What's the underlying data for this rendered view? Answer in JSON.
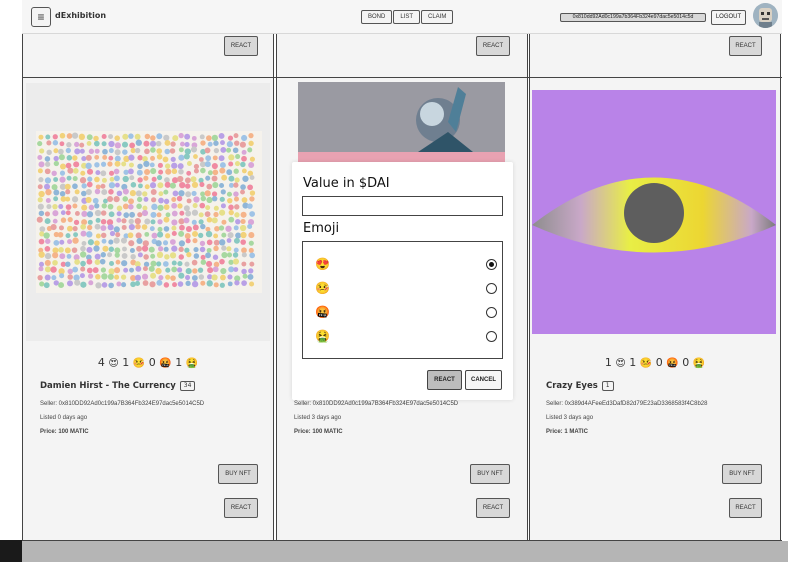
{
  "header": {
    "app_title": "dExhibition",
    "nav": [
      "BOND",
      "LIST",
      "CLAIM"
    ],
    "wallet_address": "0x810dd92Ad0c199a7b364Fb324e97dac5e5014c5d",
    "logout_label": "LOGOUT"
  },
  "top_row": {
    "react_labels": [
      "REACT",
      "REACT",
      "REACT"
    ]
  },
  "cards": [
    {
      "stats": [
        {
          "count": "4",
          "emoji": "😍"
        },
        {
          "count": "1",
          "emoji": "🤒"
        },
        {
          "count": "0",
          "emoji": "🤬"
        },
        {
          "count": "1",
          "emoji": "🤮"
        }
      ],
      "title": "Damien Hirst - The Currency",
      "badge": "34",
      "seller": "Seller: 0x810DD92Ad0c199a7B364Fb324E97dac5e5014C5D",
      "listed": "Listed 0 days ago",
      "price": "Price: 100 MATIC",
      "buy_label": "BUY NFT",
      "react_label": "REACT"
    },
    {
      "seller": "Seller: 0x810DD92Ad0c199a7B364Fb324E97dac5e5014C5D",
      "listed": "Listed 3 days ago",
      "price": "Price: 100 MATIC",
      "buy_label": "BUY NFT",
      "react_label": "REACT"
    },
    {
      "stats": [
        {
          "count": "1",
          "emoji": "😍"
        },
        {
          "count": "1",
          "emoji": "🤒"
        },
        {
          "count": "0",
          "emoji": "🤬"
        },
        {
          "count": "0",
          "emoji": "🤮"
        }
      ],
      "title": "Crazy Eyes",
      "badge": "1",
      "seller": "Seller: 0x389d4AFeeEd3DafD82d79E23aD3368583f4C8b28",
      "listed": "Listed 3 days ago",
      "price": "Price: 1 MATIC",
      "buy_label": "BUY NFT",
      "react_label": "REACT"
    }
  ],
  "modal": {
    "value_label": "Value in $DAI",
    "value_input": "",
    "emoji_label": "Emoji",
    "options": [
      {
        "emoji": "😍",
        "icon": "heart-eyes-emoji-icon",
        "selected": true
      },
      {
        "emoji": "🤒",
        "icon": "sick-face-emoji-icon",
        "selected": false
      },
      {
        "emoji": "🤬",
        "icon": "cursing-face-emoji-icon",
        "selected": false
      },
      {
        "emoji": "🤮",
        "icon": "vomiting-face-emoji-icon",
        "selected": false
      }
    ],
    "react_label": "REACT",
    "cancel_label": "CANCEL"
  },
  "colors": {
    "accent_purple": "#b983e8",
    "eye_yellow": "#e9ee4a",
    "pupil": "#5e5e5e"
  }
}
